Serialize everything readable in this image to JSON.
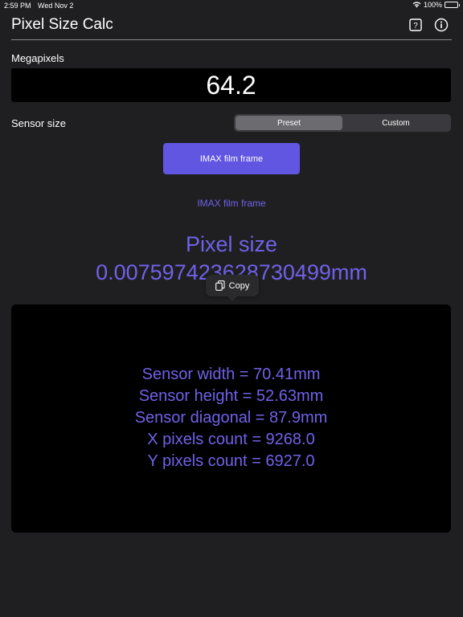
{
  "status_bar": {
    "time": "2:59 PM",
    "date": "Wed Nov 2",
    "battery": "100%"
  },
  "header": {
    "title": "Pixel Size Calc",
    "help_icon": "question-mark-square-icon",
    "info_icon": "info-circle-icon"
  },
  "megapixels": {
    "label": "Megapixels",
    "value": "64.2"
  },
  "sensor_size": {
    "label": "Sensor size",
    "segments": [
      "Preset",
      "Custom"
    ],
    "selected": "Preset"
  },
  "preset": {
    "button_label": "IMAX film frame",
    "selected_name": "IMAX film frame"
  },
  "result": {
    "label": "Pixel size",
    "value": "0.007597423628730499mm"
  },
  "copy_popup": {
    "label": "Copy",
    "icon": "copy-icon"
  },
  "details": [
    "Sensor width = 70.41mm",
    "Sensor height = 52.63mm",
    "Sensor diagonal = 87.9mm",
    "X pixels count = 9268.0",
    "Y pixels count = 6927.0"
  ],
  "colors": {
    "accent": "#6156e2",
    "accent_text": "#6f62e8",
    "background": "#1f1f21",
    "field": "#000000"
  }
}
